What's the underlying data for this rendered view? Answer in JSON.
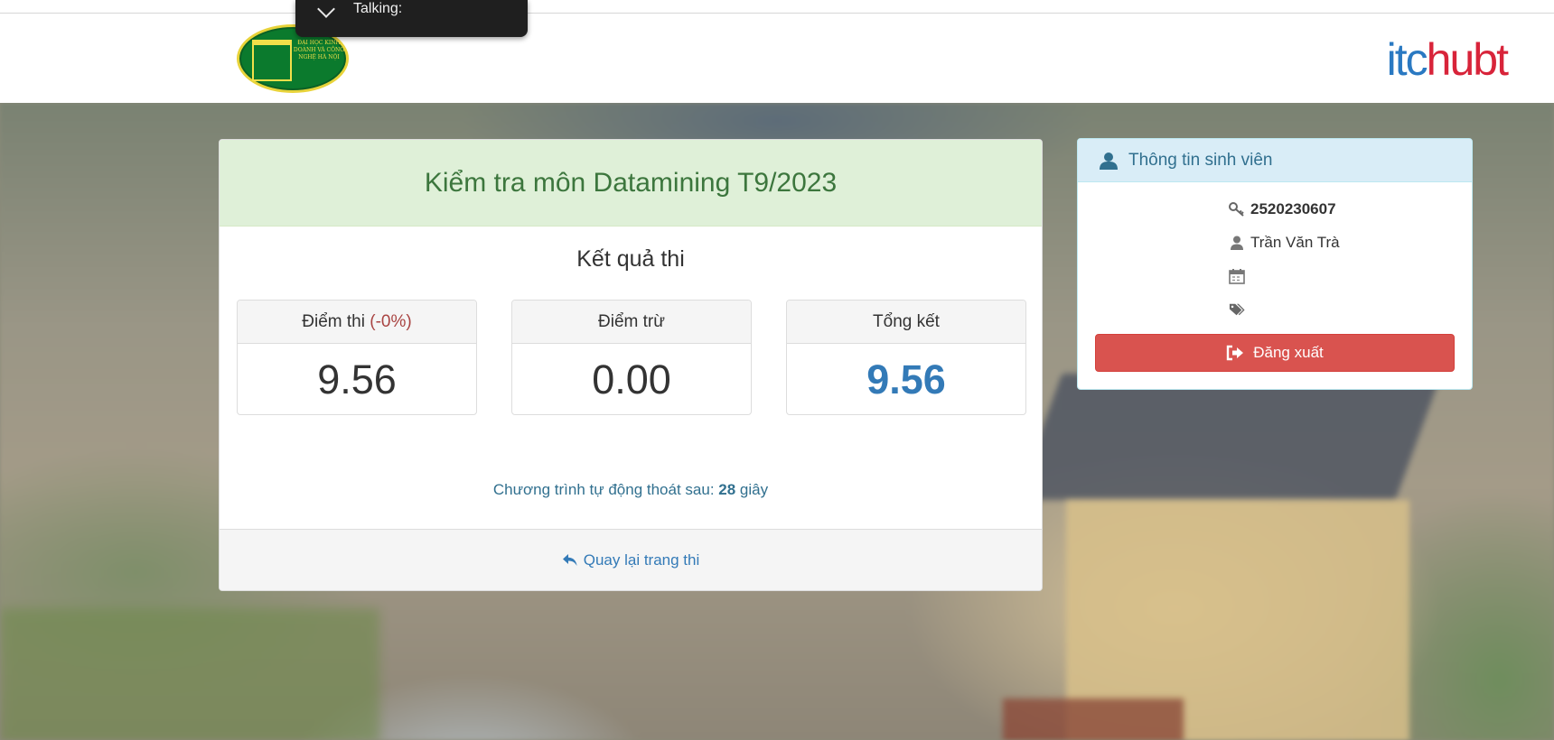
{
  "overlay": {
    "talking_label": "Talking:"
  },
  "header": {
    "left_logo_text": "ĐẠI HỌC KINH DOANH VÀ CÔNG NGHỆ HÀ NỘI",
    "brand_it": "itc",
    "brand_hub": "hubt"
  },
  "exam": {
    "title": "Kiểm tra môn Datamining T9/2023",
    "result_heading": "Kết quả thi",
    "boxes": [
      {
        "label": "Điểm thi ",
        "label_extra": "(-0%)",
        "value": "9.56"
      },
      {
        "label": "Điểm trừ",
        "value": "0.00"
      },
      {
        "label": "Tổng kết",
        "value": "9.56"
      }
    ],
    "countdown_prefix": "Chương trình tự động thoát sau: ",
    "countdown_seconds": "28",
    "countdown_suffix": " giây",
    "back_link": "Quay lại trang thi"
  },
  "student": {
    "heading": "Thông tin sinh viên",
    "id": "2520230607",
    "name": "Trần Văn Trà",
    "logout_label": "Đăng xuất",
    "icons": [
      "key-icon",
      "user-icon",
      "calendar-icon",
      "tags-icon",
      "sign-out-icon"
    ]
  },
  "colors": {
    "success_bg": "#dff0d8",
    "success_text": "#3c763d",
    "info_bg": "#d9edf7",
    "info_text": "#31708f",
    "primary": "#337ab7",
    "danger": "#d9534f",
    "brand_blue": "#2a79c2",
    "brand_red": "#d8243a"
  }
}
